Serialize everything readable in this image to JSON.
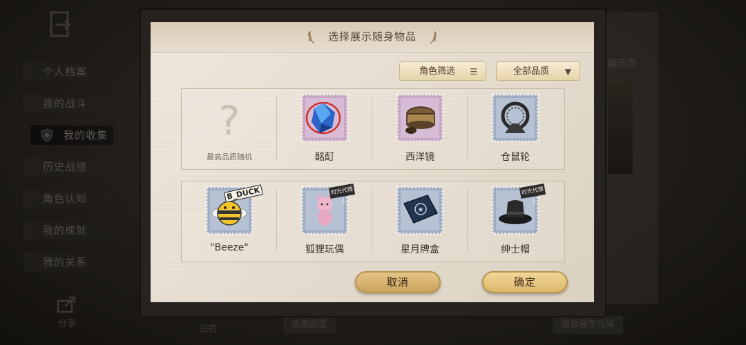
{
  "sidebar": {
    "items": [
      {
        "label": "个人档案"
      },
      {
        "label": "我的战斗"
      },
      {
        "label": "我的收集"
      },
      {
        "label": "历史战绩"
      },
      {
        "label": "角色认知"
      },
      {
        "label": "我的成就"
      },
      {
        "label": "我的关系"
      }
    ],
    "active_index": 2,
    "share_label": "分享"
  },
  "background": {
    "bottom_left_label": "归宿",
    "bottom_mid_label": "收集图鉴",
    "bottom_right_label": "编辑展示效果",
    "right_panel_label": "展示页"
  },
  "modal": {
    "title": "选择展示随身物品",
    "filters": {
      "role_filter_label": "角色筛选",
      "quality_filter_label": "全部品质"
    },
    "items": [
      {
        "label": "最高品质随机",
        "icon": "question-mark-icon"
      },
      {
        "label": "酩酊",
        "icon": "blue-gem-icon"
      },
      {
        "label": "西洋镜",
        "icon": "zoetrope-icon"
      },
      {
        "label": "仓鼠轮",
        "icon": "hamster-wheel-icon"
      },
      {
        "label": "\"Beeze\"",
        "icon": "bee-plush-icon",
        "tag": "B_DUCK"
      },
      {
        "label": "狐狸玩偶",
        "icon": "fox-doll-icon",
        "tag": "时光代理人"
      },
      {
        "label": "星月牌盒",
        "icon": "card-box-icon"
      },
      {
        "label": "绅士帽",
        "icon": "top-hat-icon",
        "tag": "时光代理人"
      }
    ],
    "cancel_label": "取消",
    "confirm_label": "确定"
  },
  "colors": {
    "paper": "#e9e1d4",
    "button_gold": "#e2c07a",
    "stamp_purple": "#c8a7c6",
    "stamp_blue": "#9faec5"
  }
}
